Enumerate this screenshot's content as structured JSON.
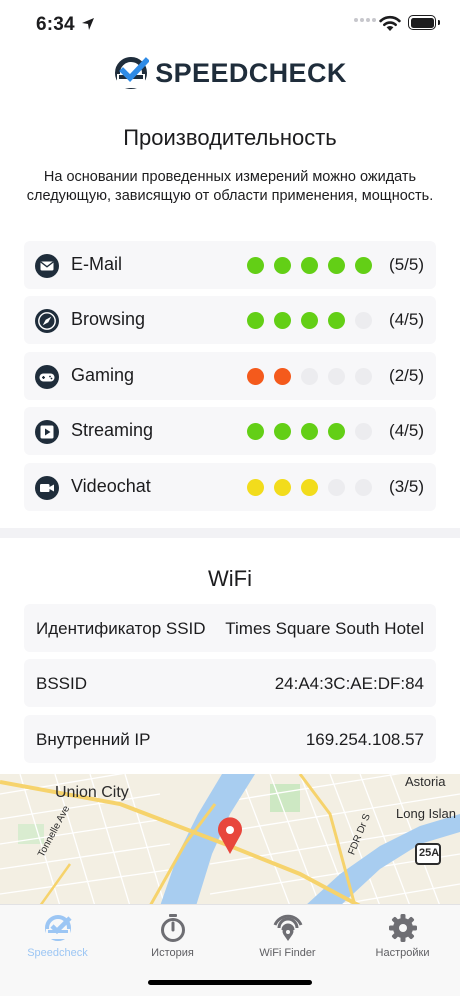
{
  "status_bar": {
    "time": "6:34"
  },
  "app": {
    "logo_text": "SPEEDCHECK"
  },
  "performance": {
    "title": "Производительность",
    "description": "На основании проведенных измерений можно ожидать следующую, зависящую от области применения, мощность.",
    "items": [
      {
        "label": "E-Mail",
        "icon": "mail-icon",
        "level": 5,
        "max": 5,
        "score": "(5/5)",
        "color": "#63cf16"
      },
      {
        "label": "Browsing",
        "icon": "compass-icon",
        "level": 4,
        "max": 5,
        "score": "(4/5)",
        "color": "#63cf16"
      },
      {
        "label": "Gaming",
        "icon": "gamepad-icon",
        "level": 2,
        "max": 5,
        "score": "(2/5)",
        "color": "#f45a1c"
      },
      {
        "label": "Streaming",
        "icon": "play-icon",
        "level": 4,
        "max": 5,
        "score": "(4/5)",
        "color": "#63cf16"
      },
      {
        "label": "Videochat",
        "icon": "video-camera-icon",
        "level": 3,
        "max": 5,
        "score": "(3/5)",
        "color": "#f2dc1c"
      }
    ]
  },
  "wifi": {
    "title": "WiFi",
    "rows": [
      {
        "key": "Идентификатор SSID",
        "value": "Times Square South Hotel"
      },
      {
        "key": "BSSID",
        "value": "24:A4:3C:AE:DF:84"
      },
      {
        "key": "Внутренний IP",
        "value": "169.254.108.57"
      }
    ]
  },
  "map": {
    "labels": {
      "union_city": "Union City",
      "astoria": "Astoria",
      "long_island": "Long Islan",
      "tonnelle": "Tonnelle Ave",
      "fdr": "FDR Dr S",
      "route": "25A"
    },
    "pin_color": "#e8463c"
  },
  "tab_bar": {
    "active_color": "#9cc6f4",
    "tabs": [
      {
        "label": "Speedcheck",
        "icon": "speedcheck-icon",
        "active": true
      },
      {
        "label": "История",
        "icon": "stopwatch-icon",
        "active": false
      },
      {
        "label": "WiFi Finder",
        "icon": "wifi-finder-icon",
        "active": false
      },
      {
        "label": "Настройки",
        "icon": "gear-icon",
        "active": false
      }
    ]
  }
}
